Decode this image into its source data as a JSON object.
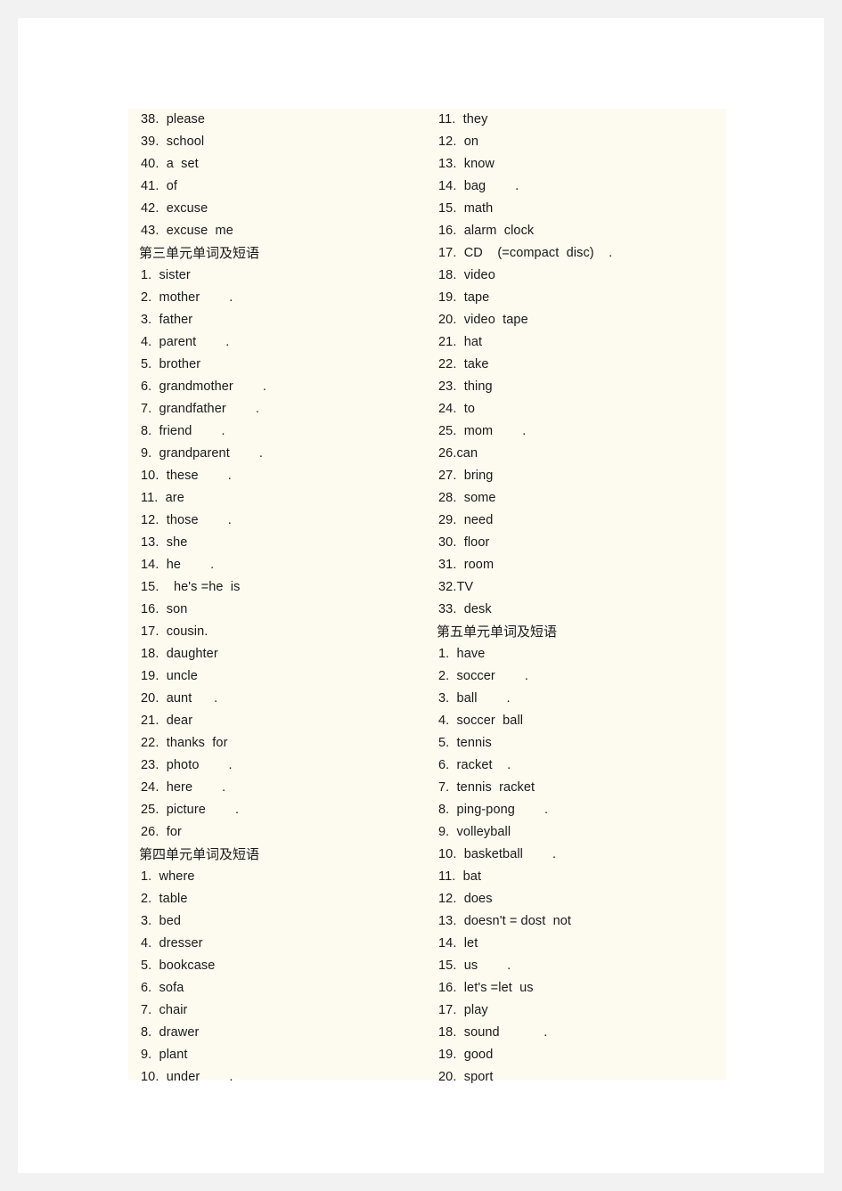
{
  "document": {
    "title": "英语单词及短语列表",
    "page_background": "#ffffff",
    "outer_background": "#f2f2f2",
    "text_block_background": "#fdfaf0",
    "text_color": "#1a1a1a"
  },
  "columns": {
    "left": [
      {
        "type": "item",
        "text": "38.  please"
      },
      {
        "type": "item",
        "text": "39.  school"
      },
      {
        "type": "item",
        "text": "40.  a  set"
      },
      {
        "type": "item",
        "text": "41.  of"
      },
      {
        "type": "item",
        "text": "42.  excuse"
      },
      {
        "type": "item",
        "text": "43.  excuse  me"
      },
      {
        "type": "heading",
        "text": "第三单元单词及短语"
      },
      {
        "type": "item",
        "text": "1.  sister"
      },
      {
        "type": "item",
        "text": "2.  mother        ."
      },
      {
        "type": "item",
        "text": "3.  father"
      },
      {
        "type": "item",
        "text": "4.  parent        ."
      },
      {
        "type": "item",
        "text": "5.  brother"
      },
      {
        "type": "item",
        "text": "6.  grandmother        ."
      },
      {
        "type": "item",
        "text": "7.  grandfather        ."
      },
      {
        "type": "item",
        "text": "8.  friend        ."
      },
      {
        "type": "item",
        "text": "9.  grandparent        ."
      },
      {
        "type": "item",
        "text": "10.  these        ."
      },
      {
        "type": "item",
        "text": "11.  are"
      },
      {
        "type": "item",
        "text": "12.  those        ."
      },
      {
        "type": "item",
        "text": "13.  she"
      },
      {
        "type": "item",
        "text": "14.  he        ."
      },
      {
        "type": "item",
        "text": "15.    he's =he  is"
      },
      {
        "type": "item",
        "text": "16.  son"
      },
      {
        "type": "item",
        "text": "17.  cousin."
      },
      {
        "type": "item",
        "text": "18.  daughter"
      },
      {
        "type": "item",
        "text": "19.  uncle"
      },
      {
        "type": "item",
        "text": "20.  aunt      ."
      },
      {
        "type": "item",
        "text": "21.  dear"
      },
      {
        "type": "item",
        "text": "22.  thanks  for"
      },
      {
        "type": "item",
        "text": "23.  photo        ."
      },
      {
        "type": "item",
        "text": "24.  here        ."
      },
      {
        "type": "item",
        "text": "25.  picture        ."
      },
      {
        "type": "item",
        "text": "26.  for"
      },
      {
        "type": "heading",
        "text": "第四单元单词及短语"
      },
      {
        "type": "item",
        "text": "1.  where"
      },
      {
        "type": "item",
        "text": "2.  table"
      },
      {
        "type": "item",
        "text": "3.  bed"
      },
      {
        "type": "item",
        "text": "4.  dresser"
      },
      {
        "type": "item",
        "text": "5.  bookcase"
      },
      {
        "type": "item",
        "text": "6.  sofa"
      },
      {
        "type": "item",
        "text": "7.  chair"
      },
      {
        "type": "item",
        "text": "8.  drawer"
      },
      {
        "type": "item",
        "text": "9.  plant"
      },
      {
        "type": "item",
        "text": "10.  under        ."
      }
    ],
    "right": [
      {
        "type": "item",
        "text": "11.  they"
      },
      {
        "type": "item",
        "text": "12.  on"
      },
      {
        "type": "item",
        "text": "13.  know"
      },
      {
        "type": "item",
        "text": "14.  bag        ."
      },
      {
        "type": "item",
        "text": "15.  math"
      },
      {
        "type": "item",
        "text": "16.  alarm  clock"
      },
      {
        "type": "item",
        "text": "17.  CD    (=compact  disc)    ."
      },
      {
        "type": "item",
        "text": "18.  video"
      },
      {
        "type": "item",
        "text": "19.  tape"
      },
      {
        "type": "item",
        "text": "20.  video  tape"
      },
      {
        "type": "item",
        "text": "21.  hat"
      },
      {
        "type": "item",
        "text": "22.  take"
      },
      {
        "type": "item",
        "text": "23.  thing"
      },
      {
        "type": "item",
        "text": "24.  to"
      },
      {
        "type": "item",
        "text": "25.  mom        ."
      },
      {
        "type": "item",
        "text": "26.can"
      },
      {
        "type": "item",
        "text": "27.  bring"
      },
      {
        "type": "item",
        "text": "28.  some"
      },
      {
        "type": "item",
        "text": "29.  need"
      },
      {
        "type": "item",
        "text": "30.  floor"
      },
      {
        "type": "item",
        "text": "31.  room"
      },
      {
        "type": "item",
        "text": "32.TV"
      },
      {
        "type": "item",
        "text": "33.  desk"
      },
      {
        "type": "heading",
        "text": "第五单元单词及短语"
      },
      {
        "type": "item",
        "text": "1.  have"
      },
      {
        "type": "item",
        "text": "2.  soccer        ."
      },
      {
        "type": "item",
        "text": "3.  ball        ."
      },
      {
        "type": "item",
        "text": "4.  soccer  ball"
      },
      {
        "type": "item",
        "text": "5.  tennis"
      },
      {
        "type": "item",
        "text": "6.  racket    ."
      },
      {
        "type": "item",
        "text": "7.  tennis  racket"
      },
      {
        "type": "item",
        "text": "8.  ping-pong        ."
      },
      {
        "type": "item",
        "text": "9.  volleyball"
      },
      {
        "type": "item",
        "text": "10.  basketball        ."
      },
      {
        "type": "item",
        "text": "11.  bat"
      },
      {
        "type": "item",
        "text": "12.  does"
      },
      {
        "type": "item",
        "text": "13.  doesn't = dost  not"
      },
      {
        "type": "item",
        "text": "14.  let"
      },
      {
        "type": "item",
        "text": "15.  us        ."
      },
      {
        "type": "item",
        "text": "16.  let's =let  us"
      },
      {
        "type": "item",
        "text": "17.  play"
      },
      {
        "type": "item",
        "text": "18.  sound            ."
      },
      {
        "type": "item",
        "text": "19.  good"
      },
      {
        "type": "item",
        "text": "20.  sport"
      }
    ]
  }
}
